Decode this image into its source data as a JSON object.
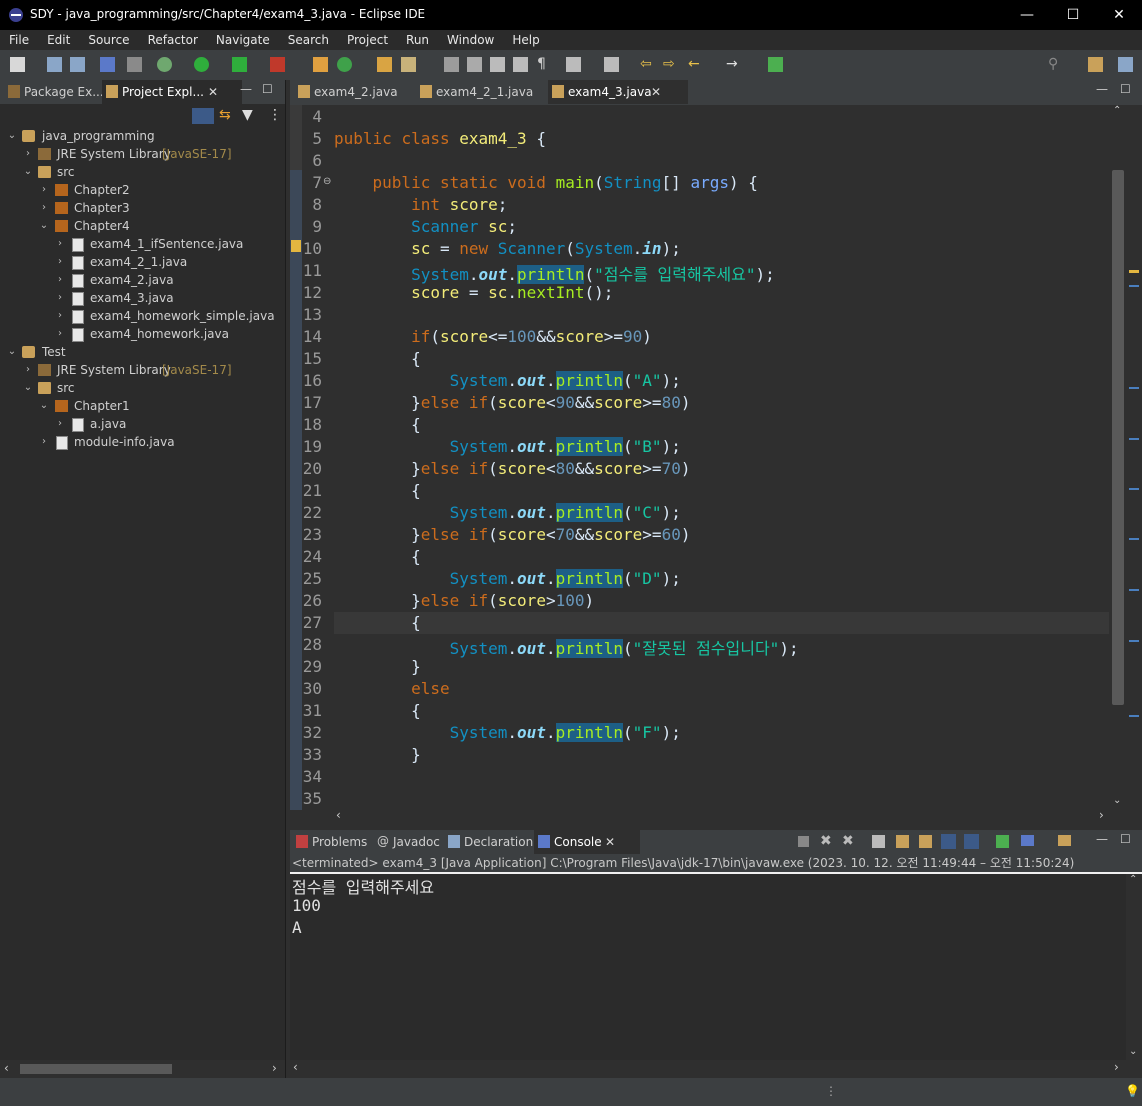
{
  "window": {
    "title": "SDY - java_programming/src/Chapter4/exam4_3.java - Eclipse IDE",
    "minimize": "—",
    "maximize": "☐",
    "close": "✕"
  },
  "menu": [
    "File",
    "Edit",
    "Source",
    "Refactor",
    "Navigate",
    "Search",
    "Project",
    "Run",
    "Window",
    "Help"
  ],
  "left_tabs": [
    {
      "label": "Package Ex..."
    },
    {
      "label": "Project Expl..."
    }
  ],
  "tree": [
    {
      "label": "java_programming",
      "icon": "project-icon",
      "depth": 0,
      "open": true
    },
    {
      "label": "JRE System Library",
      "extra": "[JavaSE-17]",
      "icon": "library-icon",
      "depth": 1,
      "open": false
    },
    {
      "label": "src",
      "icon": "source-folder-icon",
      "depth": 1,
      "open": true
    },
    {
      "label": "Chapter2",
      "icon": "package-icon",
      "depth": 2,
      "open": false
    },
    {
      "label": "Chapter3",
      "icon": "package-icon",
      "depth": 2,
      "open": false
    },
    {
      "label": "Chapter4",
      "icon": "package-icon",
      "depth": 2,
      "open": true
    },
    {
      "label": "exam4_1_ifSentence.java",
      "icon": "java-file-icon",
      "depth": 3,
      "open": false
    },
    {
      "label": "exam4_2_1.java",
      "icon": "java-file-icon",
      "depth": 3,
      "open": false
    },
    {
      "label": "exam4_2.java",
      "icon": "java-file-icon",
      "depth": 3,
      "open": false
    },
    {
      "label": "exam4_3.java",
      "icon": "java-file-icon",
      "depth": 3,
      "open": false
    },
    {
      "label": "exam4_homework_simple.java",
      "icon": "java-file-icon",
      "depth": 3,
      "open": false
    },
    {
      "label": "exam4_homework.java",
      "icon": "java-file-icon",
      "depth": 3,
      "open": false
    },
    {
      "label": "Test",
      "icon": "project-icon",
      "depth": 0,
      "open": true
    },
    {
      "label": "JRE System Library",
      "extra": "[JavaSE-17]",
      "icon": "library-icon",
      "depth": 1,
      "open": false
    },
    {
      "label": "src",
      "icon": "source-folder-icon",
      "depth": 1,
      "open": true
    },
    {
      "label": "Chapter1",
      "icon": "package-icon",
      "depth": 2,
      "open": true
    },
    {
      "label": "a.java",
      "icon": "java-file-icon",
      "depth": 3,
      "open": false
    },
    {
      "label": "module-info.java",
      "icon": "java-file-icon",
      "depth": 2,
      "open": false
    }
  ],
  "editor_tabs": [
    {
      "label": "exam4_2.java"
    },
    {
      "label": "exam4_2_1.java"
    },
    {
      "label": "exam4_3.java",
      "active": true
    }
  ],
  "code_lines": [
    {
      "n": "4",
      "text": ""
    },
    {
      "n": "5",
      "text": "public class exam4_3 {"
    },
    {
      "n": "6",
      "text": ""
    },
    {
      "n": "7",
      "text": "    public static void main(String[] args) {"
    },
    {
      "n": "8",
      "text": "        int score;"
    },
    {
      "n": "9",
      "text": "        Scanner sc;"
    },
    {
      "n": "10",
      "text": "        sc = new Scanner(System.in);"
    },
    {
      "n": "11",
      "text": "        System.out.println(\"점수를 입력해주세요\");"
    },
    {
      "n": "12",
      "text": "        score = sc.nextInt();"
    },
    {
      "n": "13",
      "text": ""
    },
    {
      "n": "14",
      "text": "        if(score<=100&&score>=90)"
    },
    {
      "n": "15",
      "text": "        {"
    },
    {
      "n": "16",
      "text": "            System.out.println(\"A\");"
    },
    {
      "n": "17",
      "text": "        }else if(score<90&&score>=80)"
    },
    {
      "n": "18",
      "text": "        {"
    },
    {
      "n": "19",
      "text": "            System.out.println(\"B\");"
    },
    {
      "n": "20",
      "text": "        }else if(score<80&&score>=70)"
    },
    {
      "n": "21",
      "text": "        {"
    },
    {
      "n": "22",
      "text": "            System.out.println(\"C\");"
    },
    {
      "n": "23",
      "text": "        }else if(score<70&&score>=60)"
    },
    {
      "n": "24",
      "text": "        {"
    },
    {
      "n": "25",
      "text": "            System.out.println(\"D\");"
    },
    {
      "n": "26",
      "text": "        }else if(score>100)"
    },
    {
      "n": "27",
      "text": "        {"
    },
    {
      "n": "28",
      "text": "            System.out.println(\"잘못된 점수입니다\");"
    },
    {
      "n": "29",
      "text": "        }"
    },
    {
      "n": "30",
      "text": "        else"
    },
    {
      "n": "31",
      "text": "        {"
    },
    {
      "n": "32",
      "text": "            System.out.println(\"F\");"
    },
    {
      "n": "33",
      "text": "        }"
    },
    {
      "n": "34",
      "text": ""
    },
    {
      "n": "35",
      "text": ""
    }
  ],
  "bottom_tabs": [
    {
      "label": "Problems"
    },
    {
      "label": "Javadoc"
    },
    {
      "label": "Declaration"
    },
    {
      "label": "Console",
      "active": true
    }
  ],
  "console": {
    "header": "<terminated> exam4_3 [Java Application] C:\\Program Files\\Java\\jdk-17\\bin\\javaw.exe  (2023. 10. 12. 오전 11:49:44 – 오전 11:50:24)",
    "output": [
      "점수를 입력해주세요",
      "100",
      "A"
    ]
  },
  "colors": {
    "keyword": "#cc6c1d",
    "type": "#1290c3",
    "string": "#17c6a3",
    "method": "#a7ec21",
    "field": "#8dd9f8"
  }
}
